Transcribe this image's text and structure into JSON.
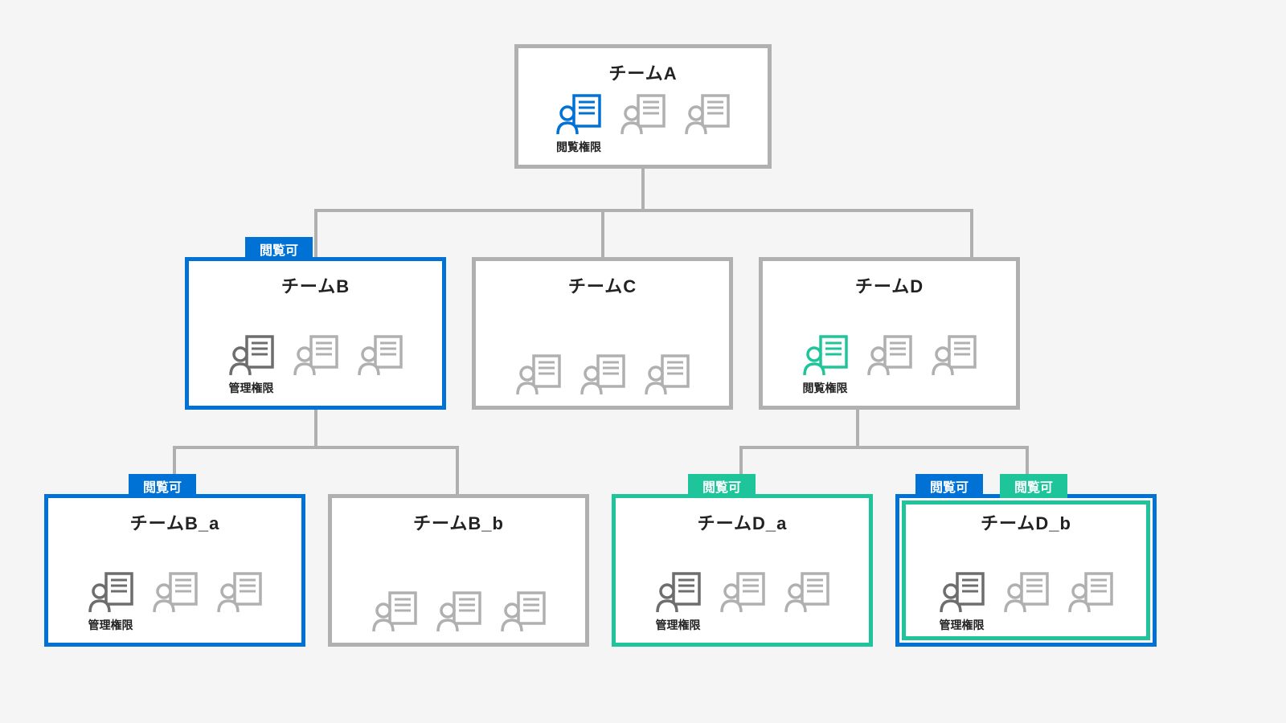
{
  "labels": {
    "badge_view": "閲覧可",
    "perm_view": "閲覧権限",
    "perm_admin": "管理権限"
  },
  "colors": {
    "gray": "#b0b0b0",
    "dark": "#6d6d6d",
    "blue": "#0072d6",
    "teal": "#1fc59a"
  },
  "nodes": {
    "A": {
      "title": "チームA",
      "border": "gray",
      "first_icon": "blue",
      "first_caption": "perm_view",
      "badges": []
    },
    "B": {
      "title": "チームB",
      "border": "blue",
      "first_icon": "dark",
      "first_caption": "perm_admin",
      "badges": [
        "blue"
      ]
    },
    "C": {
      "title": "チームC",
      "border": "gray",
      "first_icon": "gray",
      "first_caption": null,
      "badges": []
    },
    "D": {
      "title": "チームD",
      "border": "gray",
      "first_icon": "teal",
      "first_caption": "perm_view",
      "badges": []
    },
    "B_a": {
      "title": "チームB_a",
      "border": "blue",
      "first_icon": "dark",
      "first_caption": "perm_admin",
      "badges": [
        "blue"
      ]
    },
    "B_b": {
      "title": "チームB_b",
      "border": "gray",
      "first_icon": "gray",
      "first_caption": null,
      "badges": []
    },
    "D_a": {
      "title": "チームD_a",
      "border": "teal",
      "first_icon": "dark",
      "first_caption": "perm_admin",
      "badges": [
        "teal"
      ]
    },
    "D_b": {
      "title": "チームD_b",
      "border": "teal-blue",
      "first_icon": "dark",
      "first_caption": "perm_admin",
      "badges": [
        "blue",
        "teal"
      ]
    }
  },
  "tree": {
    "A": [
      "B",
      "C",
      "D"
    ],
    "B": [
      "B_a",
      "B_b"
    ],
    "D": [
      "D_a",
      "D_b"
    ]
  }
}
